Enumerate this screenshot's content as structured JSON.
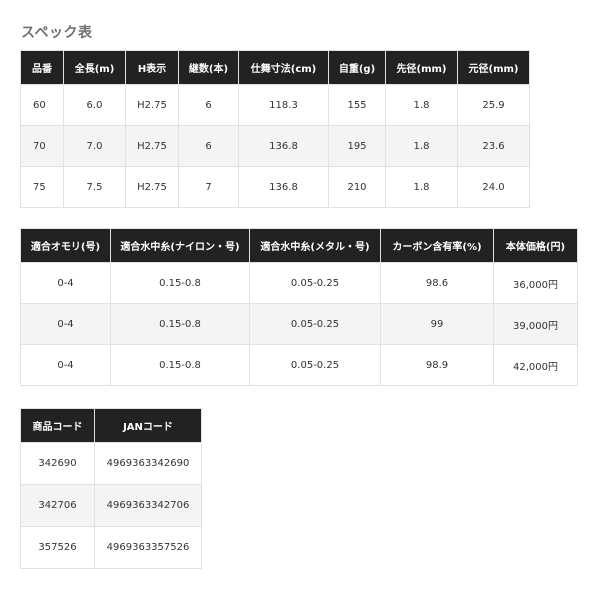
{
  "title": "スペック表",
  "table1": {
    "headers": [
      "品番",
      "全長(m)",
      "H表示",
      "継数(本)",
      "仕舞寸法(cm)",
      "自重(g)",
      "先径(mm)",
      "元径(mm)"
    ],
    "rows": [
      [
        "60",
        "6.0",
        "H2.75",
        "6",
        "118.3",
        "155",
        "1.8",
        "25.9"
      ],
      [
        "70",
        "7.0",
        "H2.75",
        "6",
        "136.8",
        "195",
        "1.8",
        "23.6"
      ],
      [
        "75",
        "7.5",
        "H2.75",
        "7",
        "136.8",
        "210",
        "1.8",
        "24.0"
      ]
    ]
  },
  "table2": {
    "headers": [
      "適合オモリ(号)",
      "適合水中糸(ナイロン・号)",
      "適合水中糸(メタル・号)",
      "カーボン含有率(%)",
      "本体価格(円)"
    ],
    "rows": [
      [
        "0-4",
        "0.15-0.8",
        "0.05-0.25",
        "98.6",
        "36,000円"
      ],
      [
        "0-4",
        "0.15-0.8",
        "0.05-0.25",
        "99",
        "39,000円"
      ],
      [
        "0-4",
        "0.15-0.8",
        "0.05-0.25",
        "98.9",
        "42,000円"
      ]
    ]
  },
  "table3": {
    "headers": [
      "商品コード",
      "JANコード"
    ],
    "rows": [
      [
        "342690",
        "4969363342690"
      ],
      [
        "342706",
        "4969363342706"
      ],
      [
        "357526",
        "4969363357526"
      ]
    ]
  }
}
